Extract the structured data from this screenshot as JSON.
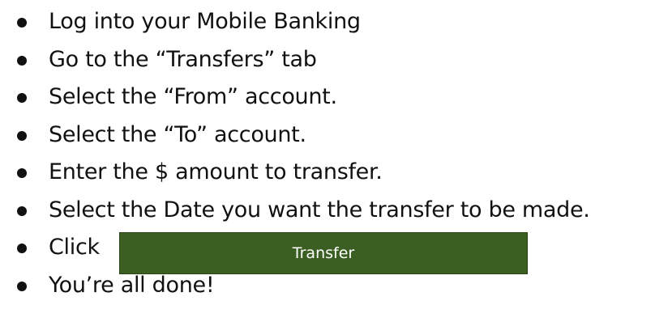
{
  "steps": [
    "Log into your Mobile Banking",
    "Go to the “Transfers” tab",
    "Select the “From” account.",
    "Select the “To” account.",
    "Enter the $ amount to transfer.",
    "Select the Date you want the transfer to be made.",
    "Click",
    "You’re all done!"
  ],
  "transfer_button": {
    "label": "Transfer",
    "color": "#3b5e23"
  }
}
